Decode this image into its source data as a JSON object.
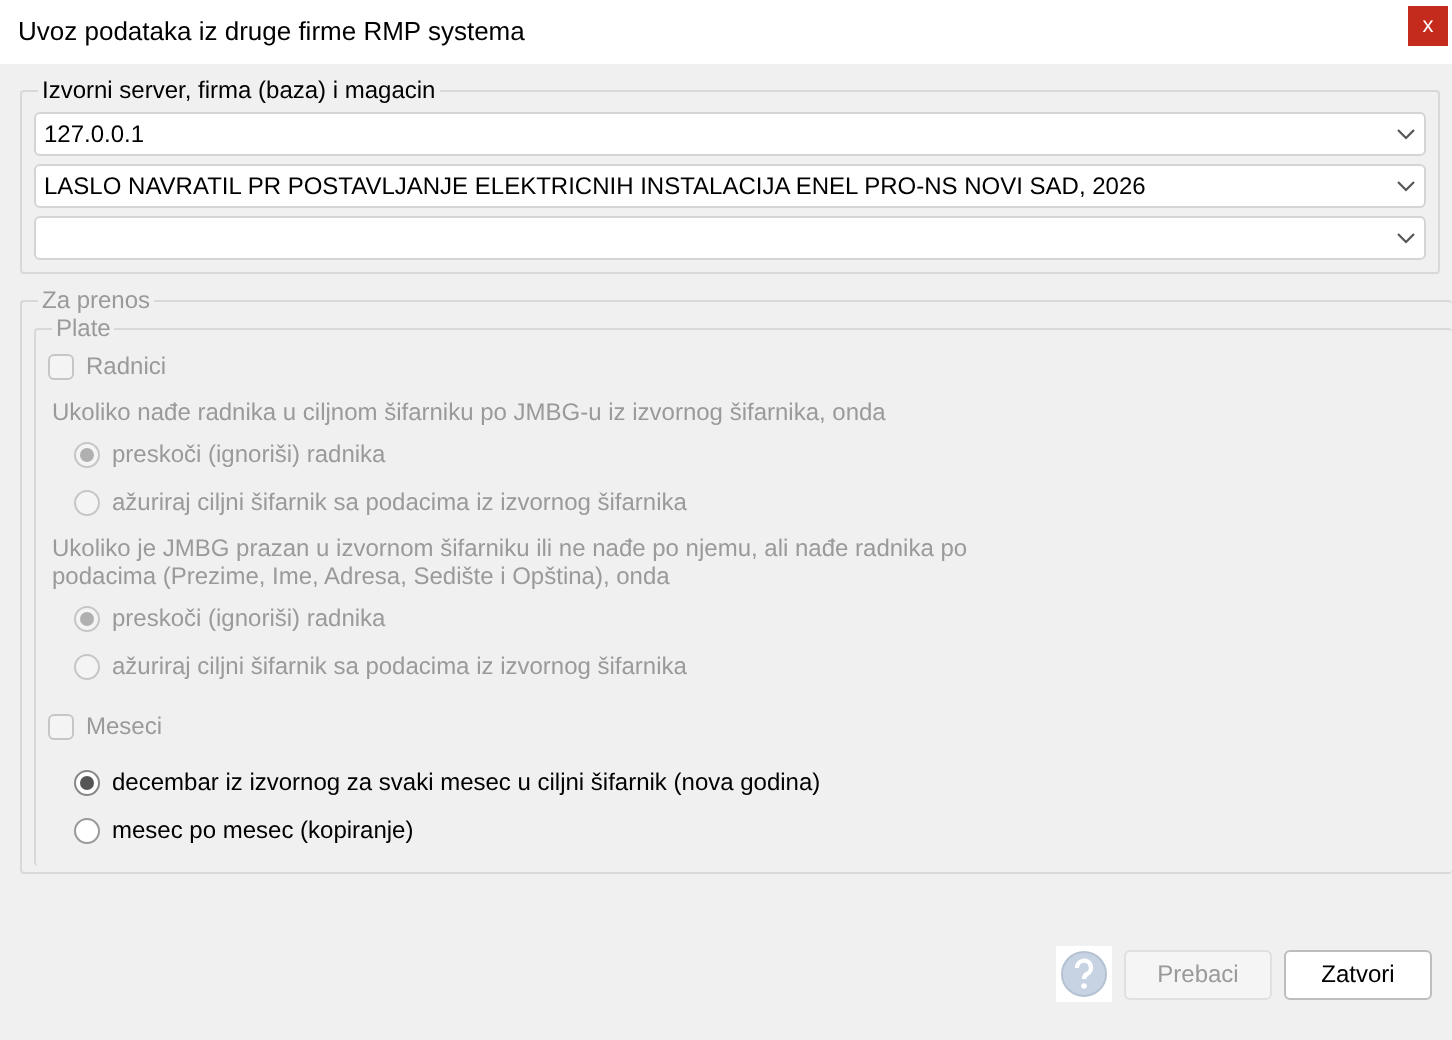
{
  "window": {
    "title": "Uvoz podataka iz druge firme RMP systema",
    "close": "x"
  },
  "source": {
    "legend": "Izvorni server, firma (baza) i magacin",
    "combos": [
      {
        "kind": "combo",
        "value": "127.0.0.1"
      },
      {
        "kind": "combo",
        "value": "LASLO NAVRATIL PR POSTAVLJANJE ELEKTRICNIH INSTALACIJA ENEL PRO-NS NOVI SAD, 2026"
      },
      {
        "kind": "combo"
      }
    ]
  },
  "transfer": {
    "legend": "Za prenos",
    "group": {
      "legend": "Plate",
      "items": [
        {
          "kind": "checkbox",
          "label": "Radnici",
          "checked": false,
          "disabled": true
        },
        {
          "kind": "note",
          "text": "Ukoliko nađe radnika u ciljnom šifarniku po JMBG-u iz izvornog šifarnika, onda"
        },
        {
          "kind": "radio",
          "label": "preskoči (ignoriši) radnika",
          "selected": true,
          "disabled": true
        },
        {
          "kind": "radio",
          "label": "ažuriraj ciljni šifarnik sa podacima iz izvornog šifarnika",
          "selected": false,
          "disabled": true
        },
        {
          "kind": "note",
          "text": "Ukoliko je JMBG prazan u izvornom šifarniku ili ne nađe po njemu, ali nađe radnika po podacima (Prezime, Ime, Adresa, Sedište i Opština), onda"
        },
        {
          "kind": "radio",
          "label": "preskoči (ignoriši) radnika",
          "selected": true,
          "disabled": true
        },
        {
          "kind": "radio",
          "label": "ažuriraj ciljni šifarnik sa podacima iz izvornog šifarnika",
          "selected": false,
          "disabled": true
        },
        {
          "kind": "checkbox",
          "label": "Meseci",
          "checked": false,
          "disabled": true
        },
        {
          "kind": "radio",
          "label": "decembar iz izvornog za svaki mesec u ciljni šifarnik (nova godina)",
          "selected": true,
          "disabled": false
        },
        {
          "kind": "radio",
          "label": "mesec po mesec (kopiranje)",
          "selected": false,
          "disabled": false
        }
      ]
    }
  },
  "buttons": [
    {
      "kind": "help"
    },
    {
      "kind": "text",
      "label": "Prebaci",
      "disabled": true
    },
    {
      "kind": "text",
      "label": "Zatvori",
      "disabled": false
    }
  ]
}
